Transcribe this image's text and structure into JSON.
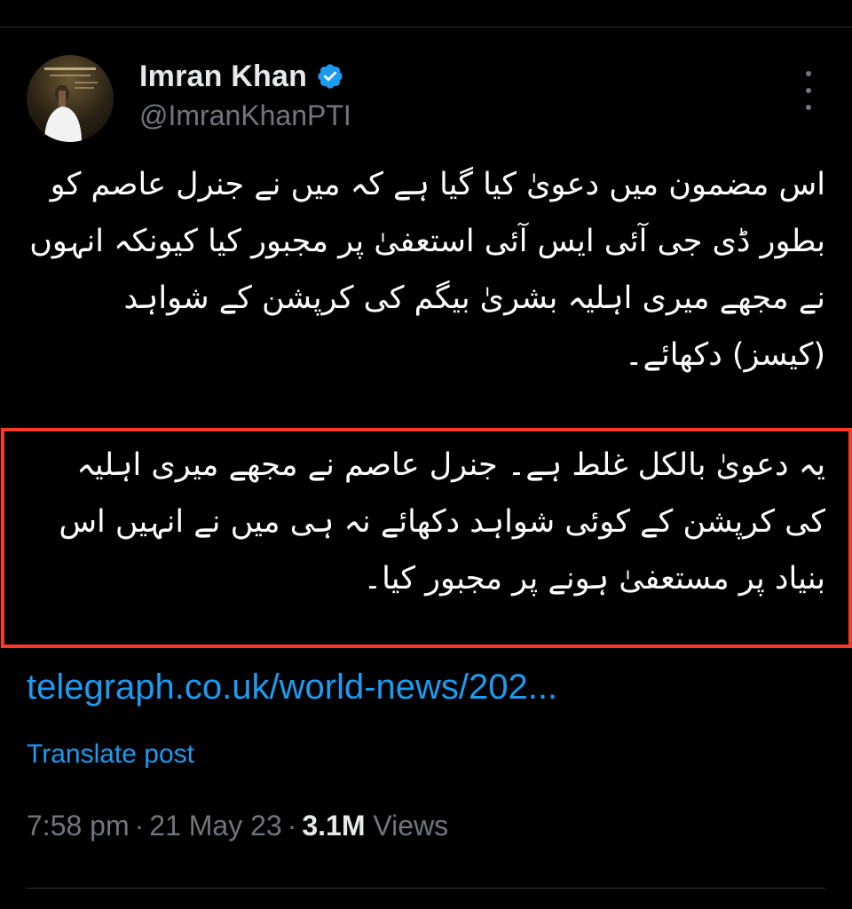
{
  "author": {
    "name": "Imran Khan",
    "handle": "@ImranKhanPTI",
    "avatar_icon": "profile-photo",
    "verified_icon": "verified-badge-icon"
  },
  "more_icon": "more-options-icon",
  "tweet": {
    "paragraph_1": "اس مضمون میں دعویٰ کیا گیا ہے کہ میں نے جنرل عاصم کو بطور ڈی جی آئی ایس آئی استعفیٰ پر مجبور کیا کیونکہ انہوں نے مجھے میری اہلیہ بشریٰ بیگم کی کرپشن کے شواہد (کیسز) دکھائے۔",
    "paragraph_2": "یہ دعویٰ بالکل غلط ہے۔ جنرل عاصم نے مجھے میری اہلیہ کی کرپشن کے کوئی شواہد دکھائے نہ ہی میں نے انہیں اس بنیاد پر مستعفیٰ ہونے پر مجبور کیا۔",
    "link": "telegraph.co.uk/world-news/202...",
    "translate_label": "Translate post"
  },
  "meta": {
    "time": "7:58 pm",
    "separator": "·",
    "date": "21 May 23",
    "views_count": "3.1M",
    "views_label": "Views"
  },
  "colors": {
    "background": "#000000",
    "accent": "#1d9bf0",
    "highlight_border": "#f53a2a",
    "secondary_text": "#71767b"
  }
}
